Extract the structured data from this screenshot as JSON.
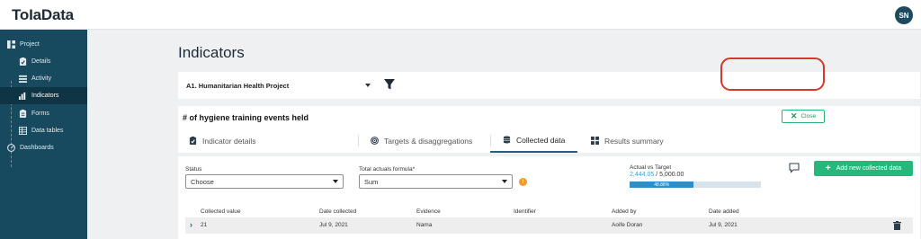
{
  "app": {
    "logo": "ToIaData",
    "user_initials": "SN"
  },
  "sidebar": {
    "items": [
      {
        "label": "Project",
        "icon": "project-icon"
      },
      {
        "label": "Details",
        "icon": "details-icon"
      },
      {
        "label": "Activity",
        "icon": "activity-icon"
      },
      {
        "label": "Indicators",
        "icon": "indicators-icon",
        "active": true
      },
      {
        "label": "Forms",
        "icon": "forms-icon"
      },
      {
        "label": "Data tables",
        "icon": "data-tables-icon"
      },
      {
        "label": "Dashboards",
        "icon": "dashboards-icon"
      }
    ]
  },
  "page": {
    "title": "Indicators"
  },
  "project_select": {
    "value": "A1. Humanitarian Health Project"
  },
  "indicator": {
    "title": "# of hygiene training events held",
    "close_label": "Close",
    "tabs": [
      {
        "label": "Indicator details",
        "icon": "clipboard-icon"
      },
      {
        "label": "Targets & disaggregations",
        "icon": "target-icon"
      },
      {
        "label": "Collected data",
        "icon": "database-icon",
        "active": true
      },
      {
        "label": "Results summary",
        "icon": "grid-icon"
      }
    ]
  },
  "collected": {
    "status_label": "Status",
    "status_value": "Choose",
    "formula_label": "Total actuals formula*",
    "formula_value": "Sum",
    "info_badge": "!",
    "avt_label": "Actual vs Target",
    "actual": "2,444.05",
    "target": "/ 5,000.00",
    "progress_text": "48.88%",
    "progress_fraction": 0.4888,
    "add_button": "Add new collected data",
    "columns": [
      "Collected value",
      "Date collected",
      "Evidence",
      "Identifier",
      "Added by",
      "Date added"
    ],
    "rows": [
      {
        "value": "21",
        "date_collected": "Jul 9, 2021",
        "evidence": "Nama",
        "identifier": "",
        "added_by": "Aoife Doran",
        "date_added": "Jul 9, 2021"
      }
    ]
  },
  "colors": {
    "primary": "#184a5f",
    "accent": "#25b87a",
    "progress": "#2f8fcb",
    "highlight": "#d23a2c"
  }
}
